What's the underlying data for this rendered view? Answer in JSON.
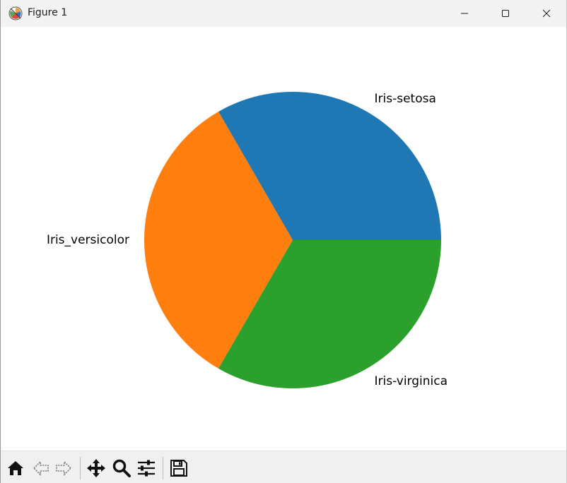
{
  "window": {
    "title": "Figure 1"
  },
  "icons": {
    "app": "matplotlib-logo-icon",
    "minimize": "minimize-icon",
    "maximize": "maximize-icon",
    "close": "close-icon",
    "home": "home-icon",
    "back": "back-arrow-icon",
    "forward": "forward-arrow-icon",
    "pan": "move-icon",
    "zoom": "magnifier-icon",
    "configure": "sliders-icon",
    "save": "floppy-disk-icon"
  },
  "chart_data": {
    "type": "pie",
    "labels": [
      "Iris-setosa",
      "Iris_versicolor",
      "Iris-virginica"
    ],
    "values": [
      50,
      50,
      50
    ],
    "colors": [
      "#1f77b4",
      "#ff7f0e",
      "#2ca02c"
    ],
    "start_angle": 0,
    "direction": "counterclockwise"
  }
}
